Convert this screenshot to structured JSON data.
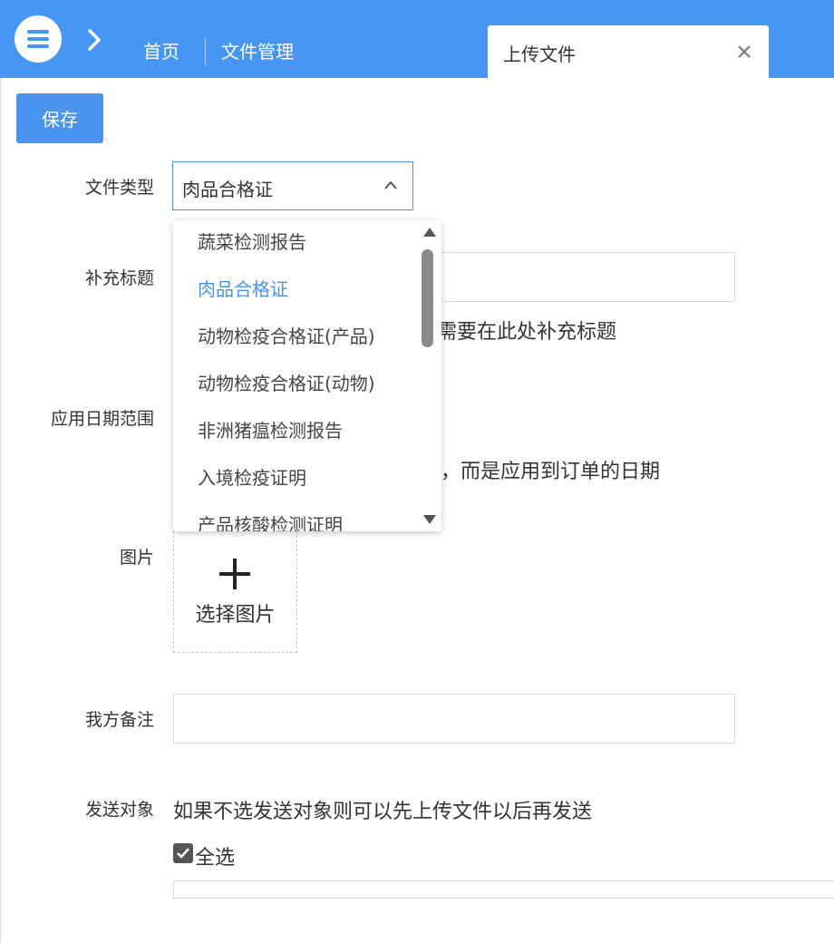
{
  "header": {
    "nav": [
      "首页",
      "文件管理"
    ],
    "active_tab": "上传文件"
  },
  "toolbar": {
    "save_label": "保存"
  },
  "form": {
    "file_type": {
      "label": "文件类型",
      "value": "肉品合格证"
    },
    "title": {
      "label": "补充标题",
      "hint": "需要在此处补充标题"
    },
    "date_range": {
      "label": "应用日期范围",
      "hint": "期，而是应用到订单的日期"
    },
    "image": {
      "label": "图片",
      "upload_text": "选择图片"
    },
    "remark": {
      "label": "我方备注"
    },
    "send_target": {
      "label": "发送对象",
      "hint": "如果不选发送对象则可以先上传文件以后再发送",
      "select_all_label": "全选",
      "select_all_checked": true
    }
  },
  "dropdown": {
    "options": [
      "蔬菜检测报告",
      "肉品合格证",
      "动物检疫合格证(产品)",
      "动物检疫合格证(动物)",
      "非洲猪瘟检测报告",
      "入境检疫证明",
      "产品核酸检测证明"
    ],
    "selected_index": 1
  },
  "colors": {
    "primary": "#4796f3",
    "selected_text": "#4a94f0"
  },
  "icons": [
    "menu-icon",
    "chevron-right-icon",
    "close-icon",
    "chevron-up-icon",
    "plus-icon",
    "checkmark-icon",
    "scroll-up-arrow-icon",
    "scroll-down-arrow-icon"
  ]
}
